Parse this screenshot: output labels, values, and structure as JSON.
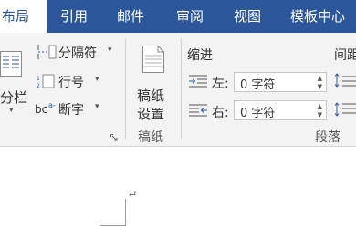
{
  "tabs": [
    {
      "label": "布局",
      "active": true
    },
    {
      "label": "引用"
    },
    {
      "label": "邮件"
    },
    {
      "label": "审阅"
    },
    {
      "label": "视图"
    },
    {
      "label": "模板中心"
    }
  ],
  "page_setup": {
    "columns_label": "分栏",
    "breaks_label": "分隔符",
    "line_numbers_label": "行号",
    "hyphenation_label": "断字",
    "dropdown_glyph": "▾"
  },
  "manuscript": {
    "button_label_line1": "稿纸",
    "button_label_line2": "设置",
    "group_label": "稿纸"
  },
  "indent": {
    "heading": "缩进",
    "left_label": "左:",
    "left_value": "0 字符",
    "right_label": "右:",
    "right_value": "0 字符"
  },
  "spacing": {
    "heading": "间距"
  },
  "paragraph": {
    "group_label": "段落"
  },
  "document": {
    "paragraph_mark": "↵"
  },
  "colors": {
    "accent": "#2b579a",
    "ribbon_bg": "#f3f3f3"
  }
}
